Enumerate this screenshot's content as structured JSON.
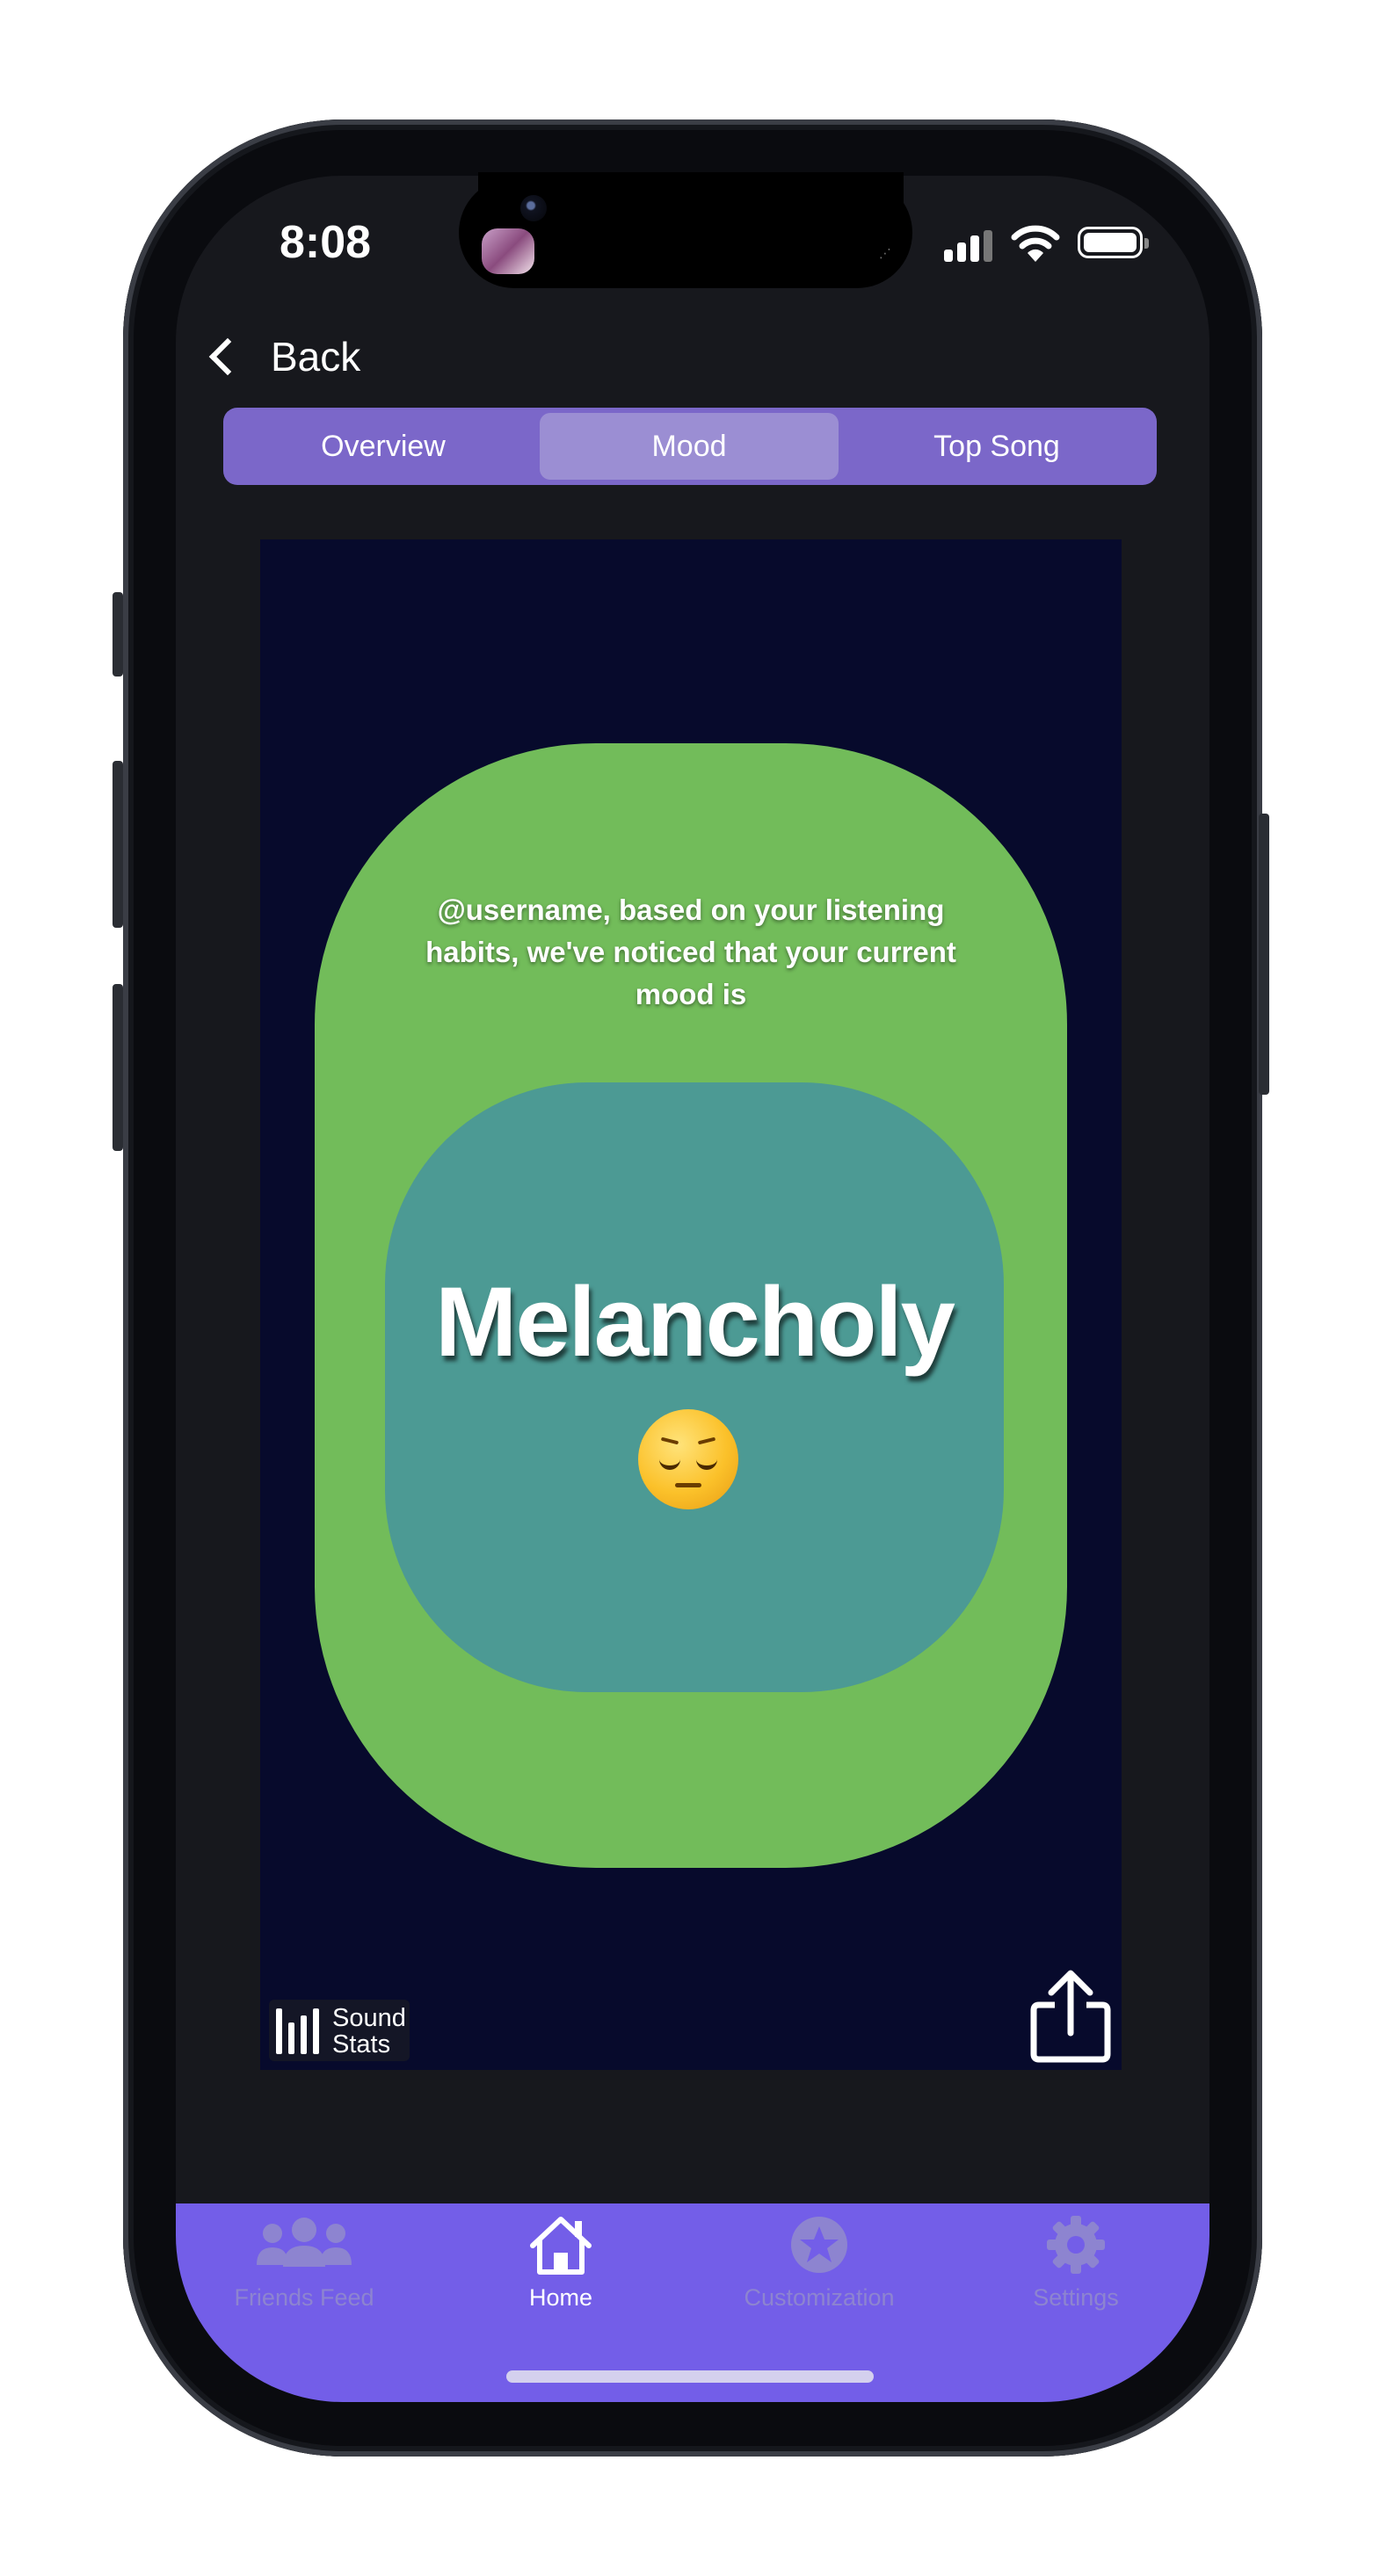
{
  "status_bar": {
    "time": "8:08"
  },
  "nav": {
    "back_label": "Back"
  },
  "segments": [
    {
      "label": "Overview",
      "active": false
    },
    {
      "label": "Mood",
      "active": true
    },
    {
      "label": "Top Song",
      "active": false
    }
  ],
  "mood_card": {
    "intro": "@username, based on your listening habits, we've noticed that your current mood is",
    "mood": "Melancholy",
    "emoji": "pensive-face",
    "colors": {
      "background": "#070a2c",
      "outer": "#72bc5a",
      "inner": "#4c9a94"
    }
  },
  "brand": {
    "logo_line1": "Sound",
    "logo_line2": "Stats"
  },
  "share": {
    "icon": "share-icon"
  },
  "tabbar": {
    "accent": "#735ee8",
    "items": [
      {
        "label": "Friends Feed",
        "icon": "friends-icon",
        "active": false
      },
      {
        "label": "Home",
        "icon": "home-icon",
        "active": true
      },
      {
        "label": "Customization",
        "icon": "star-icon",
        "active": false
      },
      {
        "label": "Settings",
        "icon": "gear-icon",
        "active": false
      }
    ]
  }
}
